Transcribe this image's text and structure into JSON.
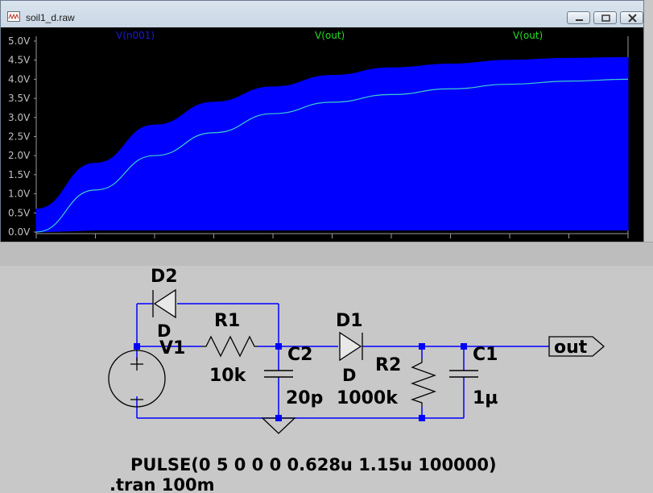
{
  "window": {
    "title": "soil1_d.raw",
    "minimize_label": "minimize",
    "maximize_label": "maximize",
    "close_label": "close"
  },
  "plot": {
    "trace_labels": [
      {
        "text": "V(n001)",
        "color": "#1a1ad6"
      },
      {
        "text": "V(out)",
        "color": "#22dd22"
      },
      {
        "text": "V(out)",
        "color": "#22dd22"
      }
    ],
    "y_ticks": [
      "5.0V",
      "4.5V",
      "4.0V",
      "3.5V",
      "3.0V",
      "2.5V",
      "2.0V",
      "1.5V",
      "1.0V",
      "0.5V",
      "0.0V"
    ],
    "colors": {
      "background": "#000000",
      "fill_trace": "#0000ff",
      "line_trace": "#3ed0c8",
      "axis_text": "#c0c0c0"
    }
  },
  "chart_data": {
    "type": "area",
    "title": "",
    "xlabel": "",
    "ylabel": "",
    "ylim": [
      0,
      5
    ],
    "grid": false,
    "series": [
      {
        "name": "V(n001)",
        "color": "#0000ff",
        "envelope_top": [
          0.6,
          1.8,
          2.8,
          3.4,
          3.8,
          4.1,
          4.3,
          4.4,
          4.5,
          4.55,
          4.57
        ],
        "envelope_bottom": [
          0.0,
          0.05,
          0.05,
          0.05,
          0.05,
          0.05,
          0.05,
          0.05,
          0.05,
          0.05,
          0.05
        ]
      },
      {
        "name": "V(out)",
        "color": "#3ed0c8",
        "values": [
          0.0,
          1.1,
          2.0,
          2.6,
          3.1,
          3.4,
          3.6,
          3.75,
          3.87,
          3.95,
          4.0
        ]
      }
    ],
    "x_samples": 11
  },
  "schematic": {
    "components": {
      "d2": {
        "name": "D2",
        "model": "D"
      },
      "v1": {
        "name": "V1"
      },
      "r1": {
        "name": "R1",
        "value": "10k"
      },
      "c2": {
        "name": "C2",
        "value": "20p"
      },
      "d1": {
        "name": "D1",
        "model": "D"
      },
      "r2": {
        "name": "R2",
        "value": "1000k"
      },
      "c1": {
        "name": "C1",
        "value": "1µ"
      }
    },
    "net_label": "out",
    "source_spec": "PULSE(0 5 0 0 0 0.628u 1.15u 100000)",
    "directive": ".tran 100m"
  }
}
